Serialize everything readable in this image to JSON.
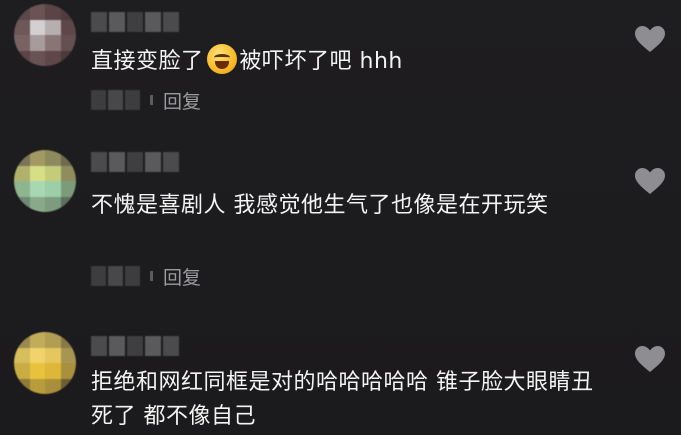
{
  "comments": [
    {
      "text_before": "直接变脸了",
      "emoji": "rofl-emoji",
      "text_after": "被吓坏了吧 hhh",
      "reply_label": "回复"
    },
    {
      "text": "不愧是喜剧人 我感觉他生气了也像是在开玩笑",
      "reply_label": "回复"
    },
    {
      "text": "拒绝和网红同框是对的哈哈哈哈哈 锥子脸大眼睛丑死了 都不像自己"
    }
  ],
  "icons": {
    "like": "heart-icon"
  },
  "colors": {
    "background": "#1c1b1d",
    "text": "#f4f4f4",
    "secondary_text": "#9b9a9e",
    "heart": "#8e8d91"
  }
}
